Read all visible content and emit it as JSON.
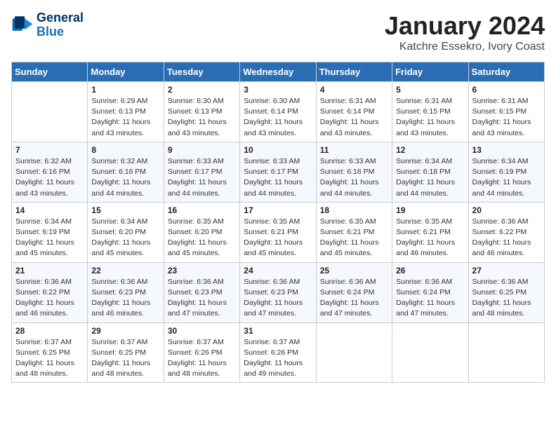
{
  "logo": {
    "line1": "General",
    "line2": "Blue"
  },
  "title": "January 2024",
  "subtitle": "Katchre Essekro, Ivory Coast",
  "days_header": [
    "Sunday",
    "Monday",
    "Tuesday",
    "Wednesday",
    "Thursday",
    "Friday",
    "Saturday"
  ],
  "weeks": [
    [
      {
        "day": "",
        "info": ""
      },
      {
        "day": "1",
        "info": "Sunrise: 6:29 AM\nSunset: 6:13 PM\nDaylight: 11 hours\nand 43 minutes."
      },
      {
        "day": "2",
        "info": "Sunrise: 6:30 AM\nSunset: 6:13 PM\nDaylight: 11 hours\nand 43 minutes."
      },
      {
        "day": "3",
        "info": "Sunrise: 6:30 AM\nSunset: 6:14 PM\nDaylight: 11 hours\nand 43 minutes."
      },
      {
        "day": "4",
        "info": "Sunrise: 6:31 AM\nSunset: 6:14 PM\nDaylight: 11 hours\nand 43 minutes."
      },
      {
        "day": "5",
        "info": "Sunrise: 6:31 AM\nSunset: 6:15 PM\nDaylight: 11 hours\nand 43 minutes."
      },
      {
        "day": "6",
        "info": "Sunrise: 6:31 AM\nSunset: 6:15 PM\nDaylight: 11 hours\nand 43 minutes."
      }
    ],
    [
      {
        "day": "7",
        "info": "Sunrise: 6:32 AM\nSunset: 6:16 PM\nDaylight: 11 hours\nand 43 minutes."
      },
      {
        "day": "8",
        "info": "Sunrise: 6:32 AM\nSunset: 6:16 PM\nDaylight: 11 hours\nand 44 minutes."
      },
      {
        "day": "9",
        "info": "Sunrise: 6:33 AM\nSunset: 6:17 PM\nDaylight: 11 hours\nand 44 minutes."
      },
      {
        "day": "10",
        "info": "Sunrise: 6:33 AM\nSunset: 6:17 PM\nDaylight: 11 hours\nand 44 minutes."
      },
      {
        "day": "11",
        "info": "Sunrise: 6:33 AM\nSunset: 6:18 PM\nDaylight: 11 hours\nand 44 minutes."
      },
      {
        "day": "12",
        "info": "Sunrise: 6:34 AM\nSunset: 6:18 PM\nDaylight: 11 hours\nand 44 minutes."
      },
      {
        "day": "13",
        "info": "Sunrise: 6:34 AM\nSunset: 6:19 PM\nDaylight: 11 hours\nand 44 minutes."
      }
    ],
    [
      {
        "day": "14",
        "info": "Sunrise: 6:34 AM\nSunset: 6:19 PM\nDaylight: 11 hours\nand 45 minutes."
      },
      {
        "day": "15",
        "info": "Sunrise: 6:34 AM\nSunset: 6:20 PM\nDaylight: 11 hours\nand 45 minutes."
      },
      {
        "day": "16",
        "info": "Sunrise: 6:35 AM\nSunset: 6:20 PM\nDaylight: 11 hours\nand 45 minutes."
      },
      {
        "day": "17",
        "info": "Sunrise: 6:35 AM\nSunset: 6:21 PM\nDaylight: 11 hours\nand 45 minutes."
      },
      {
        "day": "18",
        "info": "Sunrise: 6:35 AM\nSunset: 6:21 PM\nDaylight: 11 hours\nand 45 minutes."
      },
      {
        "day": "19",
        "info": "Sunrise: 6:35 AM\nSunset: 6:21 PM\nDaylight: 11 hours\nand 46 minutes."
      },
      {
        "day": "20",
        "info": "Sunrise: 6:36 AM\nSunset: 6:22 PM\nDaylight: 11 hours\nand 46 minutes."
      }
    ],
    [
      {
        "day": "21",
        "info": "Sunrise: 6:36 AM\nSunset: 6:22 PM\nDaylight: 11 hours\nand 46 minutes."
      },
      {
        "day": "22",
        "info": "Sunrise: 6:36 AM\nSunset: 6:23 PM\nDaylight: 11 hours\nand 46 minutes."
      },
      {
        "day": "23",
        "info": "Sunrise: 6:36 AM\nSunset: 6:23 PM\nDaylight: 11 hours\nand 47 minutes."
      },
      {
        "day": "24",
        "info": "Sunrise: 6:36 AM\nSunset: 6:23 PM\nDaylight: 11 hours\nand 47 minutes."
      },
      {
        "day": "25",
        "info": "Sunrise: 6:36 AM\nSunset: 6:24 PM\nDaylight: 11 hours\nand 47 minutes."
      },
      {
        "day": "26",
        "info": "Sunrise: 6:36 AM\nSunset: 6:24 PM\nDaylight: 11 hours\nand 47 minutes."
      },
      {
        "day": "27",
        "info": "Sunrise: 6:36 AM\nSunset: 6:25 PM\nDaylight: 11 hours\nand 48 minutes."
      }
    ],
    [
      {
        "day": "28",
        "info": "Sunrise: 6:37 AM\nSunset: 6:25 PM\nDaylight: 11 hours\nand 48 minutes."
      },
      {
        "day": "29",
        "info": "Sunrise: 6:37 AM\nSunset: 6:25 PM\nDaylight: 11 hours\nand 48 minutes."
      },
      {
        "day": "30",
        "info": "Sunrise: 6:37 AM\nSunset: 6:26 PM\nDaylight: 11 hours\nand 48 minutes."
      },
      {
        "day": "31",
        "info": "Sunrise: 6:37 AM\nSunset: 6:26 PM\nDaylight: 11 hours\nand 49 minutes."
      },
      {
        "day": "",
        "info": ""
      },
      {
        "day": "",
        "info": ""
      },
      {
        "day": "",
        "info": ""
      }
    ]
  ]
}
